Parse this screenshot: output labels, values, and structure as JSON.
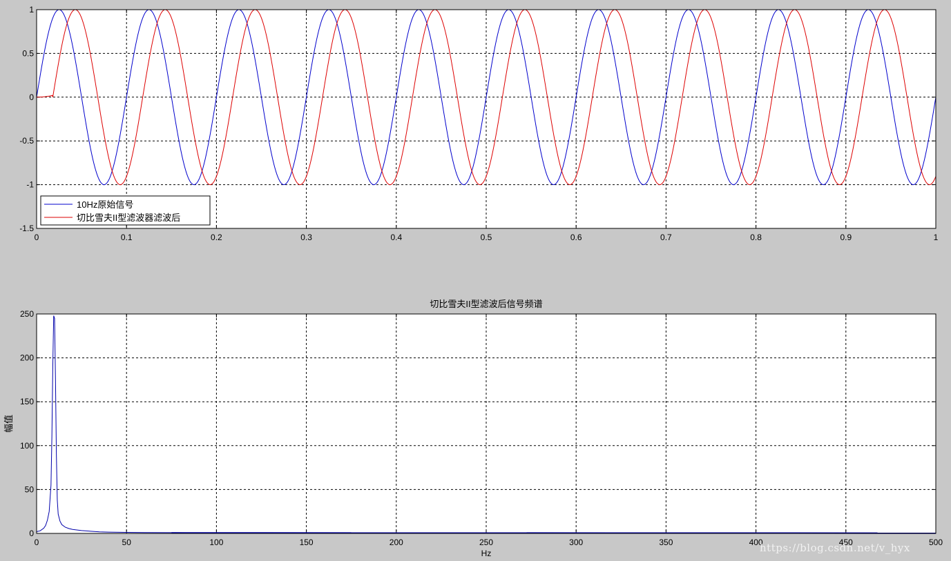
{
  "chart_data": [
    {
      "type": "line",
      "title": "",
      "xlabel": "",
      "ylabel": "",
      "xlim": [
        0,
        1
      ],
      "ylim": [
        -1.5,
        1
      ],
      "xticks": [
        "0",
        "0.1",
        "0.2",
        "0.3",
        "0.4",
        "0.5",
        "0.6",
        "0.7",
        "0.8",
        "0.9",
        "1"
      ],
      "yticks": [
        "1",
        "0.5",
        "0",
        "-0.5",
        "-1",
        "-1.5"
      ],
      "grid": true,
      "legend_position": "bottom-left",
      "series": [
        {
          "name": "10Hz原始信号",
          "color": "#0000cc",
          "frequency_hz": 10,
          "amplitude": 1,
          "phase_delay": 0,
          "x_range": [
            0,
            1
          ]
        },
        {
          "name": "切比雪夫II型滤波器滤波后",
          "color": "#dd0000",
          "frequency_hz": 10,
          "amplitude": 1,
          "phase_delay": 0.018,
          "x_range": [
            0,
            1
          ]
        }
      ]
    },
    {
      "type": "line",
      "title": "切比雪夫II型滤波后信号频谱",
      "xlabel": "Hz",
      "ylabel": "幅值",
      "xlim": [
        0,
        500
      ],
      "ylim": [
        0,
        250
      ],
      "xticks": [
        "0",
        "50",
        "100",
        "150",
        "200",
        "250",
        "300",
        "350",
        "400",
        "450",
        "500"
      ],
      "yticks": [
        "250",
        "200",
        "150",
        "100",
        "50",
        "0"
      ],
      "grid": true,
      "series": [
        {
          "name": "",
          "color": "#0000aa",
          "x": [
            0,
            2,
            4,
            5,
            6,
            7,
            8,
            8.5,
            9,
            9.5,
            10,
            10.5,
            11,
            11.5,
            12,
            13,
            14,
            16,
            18,
            20,
            25,
            30,
            35,
            40,
            50,
            60,
            75,
            100,
            150,
            200,
            300,
            400,
            500
          ],
          "y": [
            2,
            3,
            6,
            9,
            15,
            25,
            55,
            110,
            190,
            248,
            245,
            175,
            90,
            38,
            22,
            14,
            10,
            7,
            5.5,
            4.5,
            3.2,
            2.5,
            1.8,
            1.5,
            1.2,
            1.0,
            0.9,
            0.5,
            0.4,
            0.3,
            0.25,
            0.2,
            0.2
          ]
        }
      ]
    }
  ],
  "watermark": "https://blog.csdn.net/v_hyx"
}
